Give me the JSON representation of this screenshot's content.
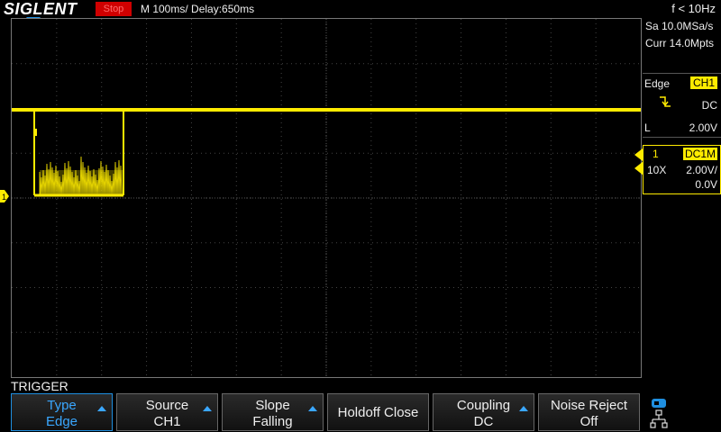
{
  "header": {
    "brand": "SIGLENT",
    "run_state": "Stop",
    "timebase": "M 100ms/",
    "delay": "Delay:650ms",
    "frequency": "f < 10Hz"
  },
  "acquisition": {
    "sample_rate": "Sa 10.0MSa/s",
    "memory_depth": "Curr 14.0Mpts"
  },
  "trigger_panel": {
    "type": "Edge",
    "source": "CH1",
    "coupling": "DC",
    "level_label": "L",
    "level": "2.00V"
  },
  "channel1": {
    "number": "1",
    "coupling": "DC1M",
    "probe": "10X",
    "scale": "2.00V/",
    "offset": "0.0V",
    "color": "#ffeb00",
    "marker_label": "1"
  },
  "menu": {
    "title": "TRIGGER",
    "buttons": [
      {
        "line1": "Type",
        "line2": "Edge"
      },
      {
        "line1": "Source",
        "line2": "CH1"
      },
      {
        "line1": "Slope",
        "line2": "Falling"
      },
      {
        "line1": "Holdoff Close",
        "line2": ""
      },
      {
        "line1": "Coupling",
        "line2": "DC"
      },
      {
        "line1": "Noise Reject",
        "line2": "Off"
      }
    ]
  },
  "colors": {
    "trace": "#ffeb00",
    "accent": "#1f8fe0",
    "stop": "#d00000"
  }
}
